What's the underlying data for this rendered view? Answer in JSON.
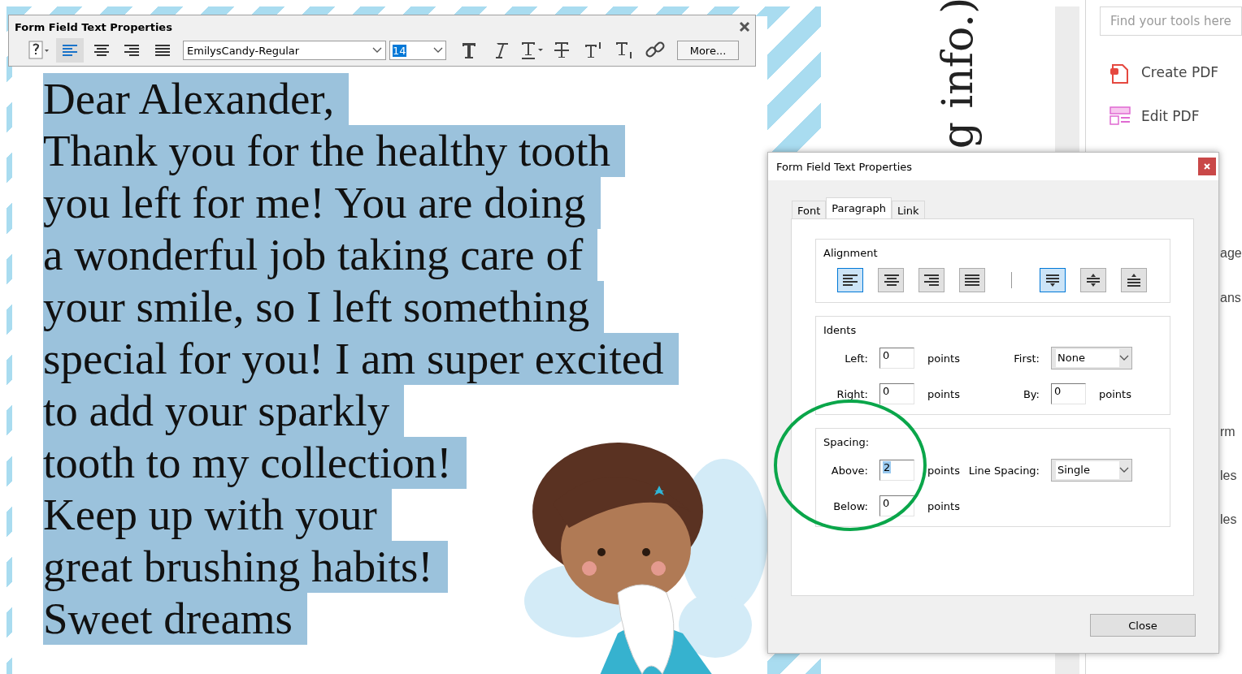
{
  "toolbar": {
    "title": "Form Field Text Properties",
    "alignments": [
      {
        "kind": "left",
        "selected": true
      },
      {
        "kind": "center",
        "selected": false
      },
      {
        "kind": "right",
        "selected": false
      },
      {
        "kind": "justify",
        "selected": false
      }
    ],
    "font": "EmilysCandy-Regular",
    "size": {
      "value": "14",
      "highlighted": true
    },
    "styles": [
      {
        "kind": "bold"
      },
      {
        "kind": "italic"
      },
      {
        "kind": "underline"
      },
      {
        "kind": "strike"
      },
      {
        "kind": "superscript"
      },
      {
        "kind": "subscript"
      },
      {
        "kind": "link"
      }
    ],
    "more_button": "More..."
  },
  "letter": {
    "lines": [
      "Dear Alexander,",
      "Thank you for the healthy tooth",
      "you left for me! You are doing",
      "a wonderful job taking care of",
      "your smile, so I left something",
      "special for you! I am super excited",
      "to add your sparkly",
      "tooth to my collection!",
      "Keep up with your",
      "great brushing habits!",
      "Sweet dreams"
    ]
  },
  "side_text": "g info.)",
  "tools_panel": {
    "search": {
      "placeholder": "Find your tools here"
    },
    "tools": [
      {
        "kind": "create",
        "label": "Create PDF"
      },
      {
        "kind": "edit",
        "label": "Edit PDF"
      }
    ],
    "cut_labels": [
      "age",
      "ans",
      "rm",
      "les",
      "les"
    ]
  },
  "dialog": {
    "title": "Form Field Text Properties",
    "tabs": [
      {
        "label": "Font",
        "selected": false
      },
      {
        "label": "Paragraph",
        "selected": true
      },
      {
        "label": "Link",
        "selected": false
      }
    ],
    "alignment": {
      "legend": "Alignment",
      "horizontal": [
        {
          "kind": "left",
          "selected": true
        },
        {
          "kind": "center",
          "selected": false
        },
        {
          "kind": "right",
          "selected": false
        },
        {
          "kind": "justify",
          "selected": false
        }
      ],
      "vertical": [
        {
          "kind": "top",
          "selected": true
        },
        {
          "kind": "middle",
          "selected": false
        },
        {
          "kind": "bottom",
          "selected": false
        }
      ]
    },
    "indents": {
      "legend": "Idents",
      "left": {
        "label": "Left:",
        "value": "0",
        "unit": "points"
      },
      "first": {
        "label": "First:",
        "value": "None"
      },
      "right": {
        "label": "Right:",
        "value": "0",
        "unit": "points"
      },
      "by": {
        "label": "By:",
        "value": "0",
        "unit": "points"
      }
    },
    "spacing": {
      "legend": "Spacing:",
      "above": {
        "label": "Above:",
        "value": "2",
        "unit": "points",
        "highlighted": true
      },
      "line_spacing": {
        "label": "Line Spacing:",
        "value": "Single"
      },
      "below": {
        "label": "Below:",
        "value": "0",
        "unit": "points"
      }
    },
    "close_button": "Close"
  }
}
